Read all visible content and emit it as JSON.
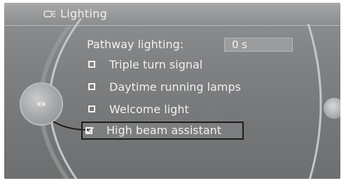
{
  "header": {
    "title": "Lighting",
    "icon": "lighting-menu-icon"
  },
  "settings": {
    "pathway_label": "Pathway lighting:",
    "pathway_value": "0 s"
  },
  "options": [
    {
      "label": "Triple turn signal",
      "checked": false
    },
    {
      "label": "Daytime running lamps",
      "checked": false
    },
    {
      "label": "Welcome light",
      "checked": false
    },
    {
      "label": "High beam assistant",
      "checked": true,
      "selected": true
    }
  ]
}
